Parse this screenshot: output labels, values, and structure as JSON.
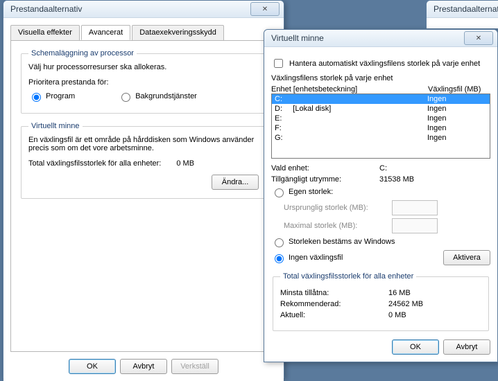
{
  "perf": {
    "title": "Prestandaalternativ",
    "tabs": {
      "visual": "Visuella effekter",
      "advanced": "Avancerat",
      "dep": "Dataexekveringsskydd"
    },
    "sched": {
      "legend": "Schemaläggning av processor",
      "desc": "Välj hur processorresurser ska allokeras.",
      "prioLabel": "Prioritera prestanda för:",
      "programs": "Program",
      "bgservices": "Bakgrundstjänster"
    },
    "vm": {
      "legend": "Virtuellt minne",
      "desc": "En växlingsfil är ett område på hårddisken som Windows använder precis som om det vore arbetsminne.",
      "totalLabel": "Total växlingsfilsstorlek för alla enheter:",
      "totalValue": "0 MB",
      "change": "Ändra..."
    },
    "buttons": {
      "ok": "OK",
      "cancel": "Avbryt",
      "apply": "Verkställ"
    }
  },
  "vmdlg": {
    "title": "Virtuellt minne",
    "autoManage": "Hantera automatiskt växlingsfilens storlek på varje enhet",
    "sizeEach": "Växlingsfilens storlek på varje enhet",
    "colDrive": "Enhet [enhetsbeteckning]",
    "colPage": "Växlingsfil (MB)",
    "drives": [
      {
        "d": "C:",
        "label": "",
        "p": "Ingen"
      },
      {
        "d": "D:",
        "label": "[Lokal disk]",
        "p": "Ingen"
      },
      {
        "d": "E:",
        "label": "",
        "p": "Ingen"
      },
      {
        "d": "F:",
        "label": "",
        "p": "Ingen"
      },
      {
        "d": "G:",
        "label": "",
        "p": "Ingen"
      }
    ],
    "selDriveLabel": "Vald enhet:",
    "selDriveValue": "C:",
    "freeLabel": "Tillgängligt utrymme:",
    "freeValue": "31538 MB",
    "custom": "Egen storlek:",
    "initLabel": "Ursprunglig storlek (MB):",
    "maxLabel": "Maximal storlek (MB):",
    "sysManaged": "Storleken bestäms av Windows",
    "noPage": "Ingen växlingsfil",
    "activate": "Aktivera",
    "totalsLegend": "Total växlingsfilsstorlek för alla enheter",
    "minLabel": "Minsta tillåtna:",
    "minValue": "16 MB",
    "recLabel": "Rekommenderad:",
    "recValue": "24562 MB",
    "curLabel": "Aktuell:",
    "curValue": "0 MB",
    "ok": "OK",
    "cancel": "Avbryt"
  },
  "stub": {
    "title": "Prestandaalternat"
  }
}
